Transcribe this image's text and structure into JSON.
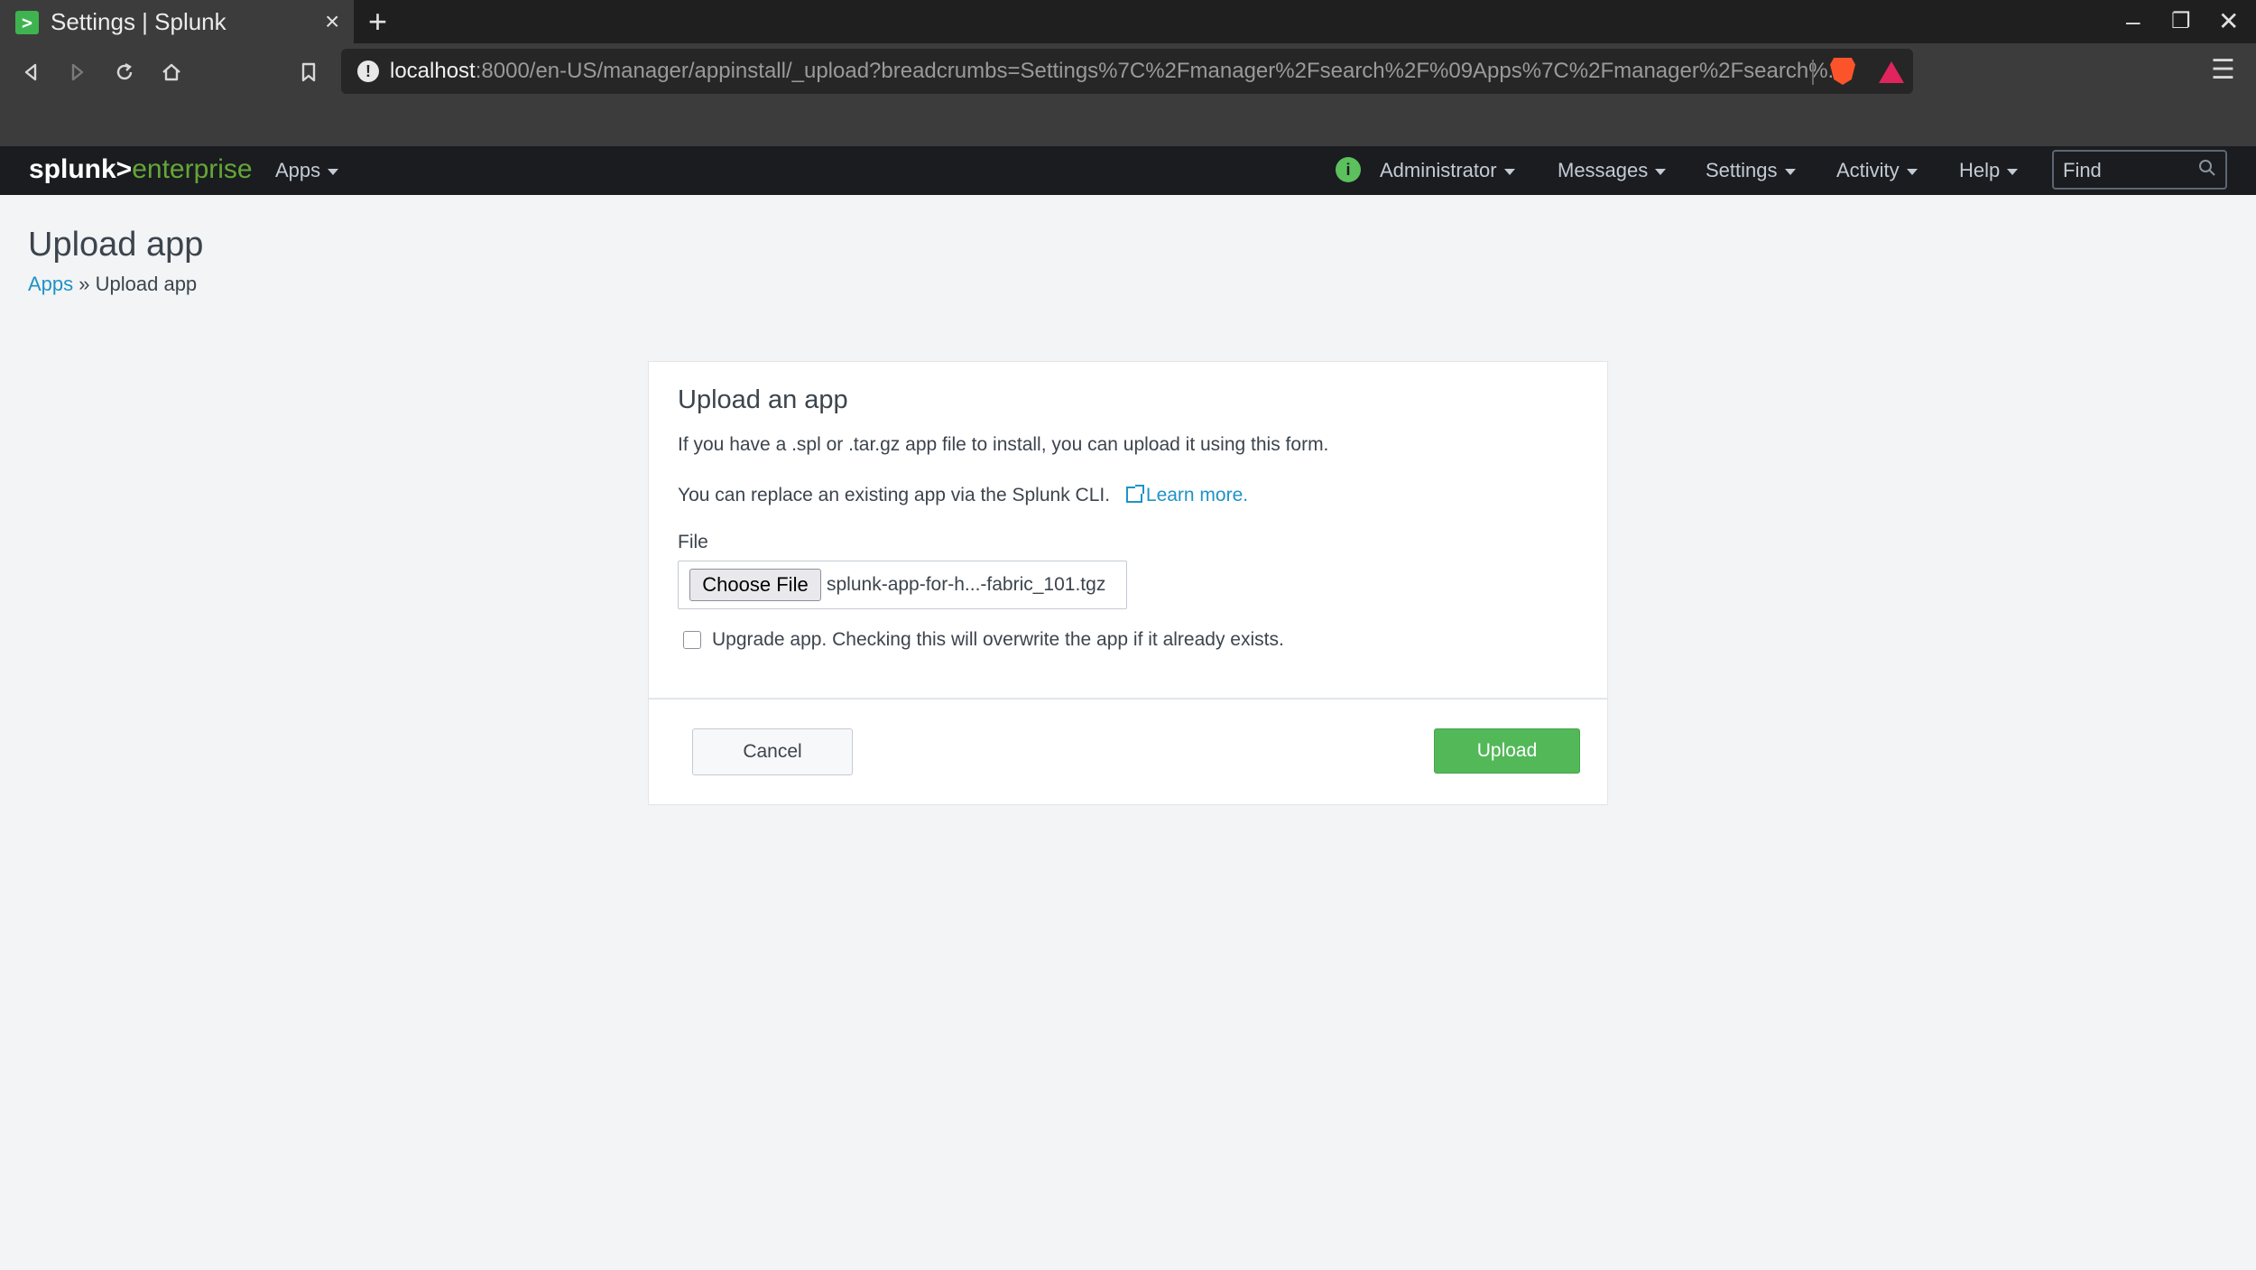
{
  "browser": {
    "tab_title": "Settings | Splunk",
    "tab_favicon": ">",
    "tab_close": "×",
    "new_tab": "+",
    "url_host": "localhost",
    "url_rest": ":8000/en-US/manager/appinstall/_upload?breadcrumbs=Settings%7C%2Fmanager%2Fsearch%2F%09Apps%7C%2Fmanager%2Fsearch%...",
    "url_info": "!",
    "icons": [
      "back-icon",
      "forward-icon",
      "reload-icon",
      "home-icon",
      "bookmark-icon",
      "brave-shield-icon",
      "brave-rewards-icon",
      "menu-icon"
    ]
  },
  "splunk_header": {
    "logo_primary": "splunk>",
    "logo_secondary": "enterprise",
    "status_glyph": "i",
    "nav": {
      "apps": "Apps",
      "administrator": "Administrator",
      "messages": "Messages",
      "settings": "Settings",
      "activity": "Activity",
      "help": "Help"
    },
    "find_placeholder": "Find"
  },
  "page": {
    "title": "Upload app",
    "breadcrumb_link": "Apps",
    "breadcrumb_sep": " » ",
    "breadcrumb_current": "Upload app"
  },
  "panel": {
    "title": "Upload an app",
    "intro": "If you have a .spl or .tar.gz app file to install, you can upload it using this form.",
    "replace_text": "You can replace an existing app via the Splunk CLI.",
    "learn_more": "Learn more.",
    "file_label": "File",
    "choose_file": "Choose File",
    "file_name": "splunk-app-for-h...-fabric_101.tgz",
    "upgrade_label": "Upgrade app. Checking this will overwrite the app if it already exists.",
    "cancel": "Cancel",
    "upload": "Upload"
  },
  "colors": {
    "accent_green": "#53b858",
    "link_blue": "#1e93c6",
    "header_bg": "#1a1c20",
    "page_bg": "#f2f4f5"
  }
}
